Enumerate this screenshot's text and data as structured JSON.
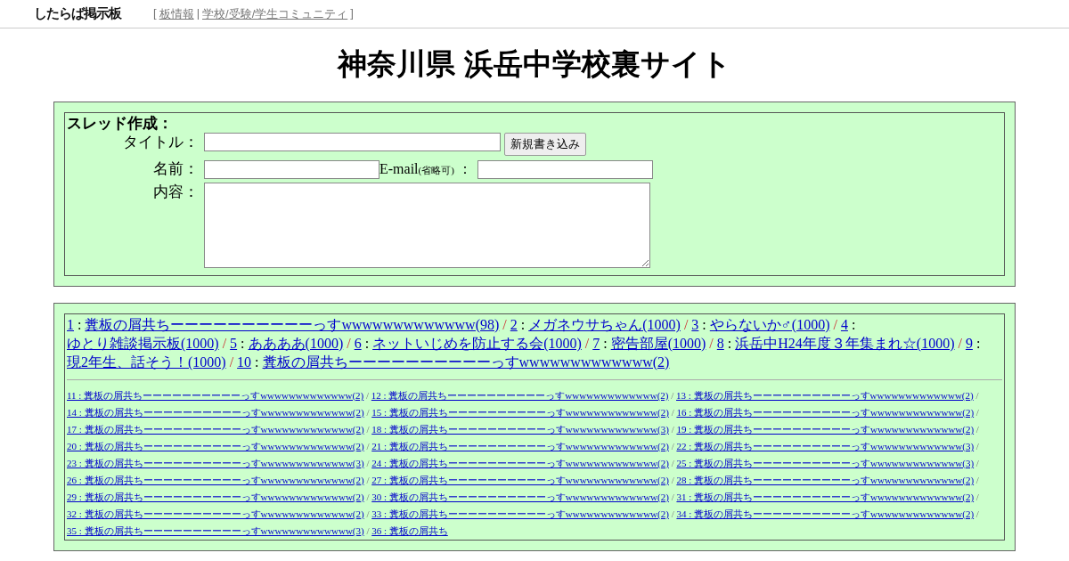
{
  "header": {
    "logo": "したらば掲示板",
    "open_bracket": "[",
    "links": [
      "板情報",
      "学校/受験/学生コミュニティ"
    ],
    "link_divider": "|",
    "close_bracket": "]"
  },
  "title": "神奈川県 浜岳中学校裏サイト",
  "form": {
    "heading": "スレッド作成：",
    "title_label": "タイトル：",
    "submit": "新規書き込み",
    "name_label": "名前：",
    "email_label": "E-mail",
    "email_note": "(省略可)",
    "email_colon": "：",
    "body_label": "内容："
  },
  "separator": "/",
  "colon": ":",
  "top_threads": [
    {
      "number": "1",
      "title": "糞板の屑共ちーーーーーーーーーーっすwwwwwwwwwwwww(98)"
    },
    {
      "number": "2",
      "title": "メガネウサちゃん(1000)"
    },
    {
      "number": "3",
      "title": "やらないか♂(1000)"
    },
    {
      "number": "4",
      "title": "ゆとり雑談掲示板(1000)"
    },
    {
      "number": "5",
      "title": "ああああ(1000)"
    },
    {
      "number": "6",
      "title": "ネットいじめを防止する会(1000)"
    },
    {
      "number": "7",
      "title": "密告部屋(1000)"
    },
    {
      "number": "8",
      "title": "浜岳中H24年度３年集まれ☆(1000)"
    },
    {
      "number": "9",
      "title": "現2年生、話そう！(1000)"
    },
    {
      "number": "10",
      "title": "糞板の屑共ちーーーーーーーーーーっすwwwwwwwwwwwww(2)"
    }
  ],
  "more_threads": [
    "11 : 糞板の屑共ちーーーーーーーーーーっすwwwwwwwwwwwww(2)",
    "12 : 糞板の屑共ちーーーーーーーーーーっすwwwwwwwwwwwww(2)",
    "13 : 糞板の屑共ちーーーーーーーーーーっすwwwwwwwwwwwww(2)",
    "14 : 糞板の屑共ちーーーーーーーーーーっすwwwwwwwwwwwww(2)",
    "15 : 糞板の屑共ちーーーーーーーーーーっすwwwwwwwwwwwww(2)",
    "16 : 糞板の屑共ちーーーーーーーーーーっすwwwwwwwwwwwww(2)",
    "17 : 糞板の屑共ちーーーーーーーーーーっすwwwwwwwwwwwww(2)",
    "18 : 糞板の屑共ちーーーーーーーーーーっすwwwwwwwwwwwww(3)",
    "19 : 糞板の屑共ちーーーーーーーーーーっすwwwwwwwwwwwww(2)",
    "20 : 糞板の屑共ちーーーーーーーーーーっすwwwwwwwwwwwww(2)",
    "21 : 糞板の屑共ちーーーーーーーーーーっすwwwwwwwwwwwww(2)",
    "22 : 糞板の屑共ちーーーーーーーーーーっすwwwwwwwwwwwww(3)",
    "23 : 糞板の屑共ちーーーーーーーーーーっすwwwwwwwwwwwww(3)",
    "24 : 糞板の屑共ちーーーーーーーーーーっすwwwwwwwwwwwww(2)",
    "25 : 糞板の屑共ちーーーーーーーーーーっすwwwwwwwwwwwww(3)",
    "26 : 糞板の屑共ちーーーーーーーーーーっすwwwwwwwwwwwww(2)",
    "27 : 糞板の屑共ちーーーーーーーーーーっすwwwwwwwwwwwww(2)",
    "28 : 糞板の屑共ちーーーーーーーーーーっすwwwwwwwwwwwww(2)",
    "29 : 糞板の屑共ちーーーーーーーーーーっすwwwwwwwwwwwww(2)",
    "30 : 糞板の屑共ちーーーーーーーーーーっすwwwwwwwwwwwww(2)",
    "31 : 糞板の屑共ちーーーーーーーーーーっすwwwwwwwwwwwww(2)",
    "32 : 糞板の屑共ちーーーーーーーーーーっすwwwwwwwwwwwww(2)",
    "33 : 糞板の屑共ちーーーーーーーーーーっすwwwwwwwwwwwww(2)",
    "34 : 糞板の屑共ちーーーーーーーーーーっすwwwwwwwwwwwww(2)",
    "35 : 糞板の屑共ちーーーーーーーーーーっすwwwwwwwwwwwww(3)",
    "36 : 糞板の屑共ち"
  ]
}
